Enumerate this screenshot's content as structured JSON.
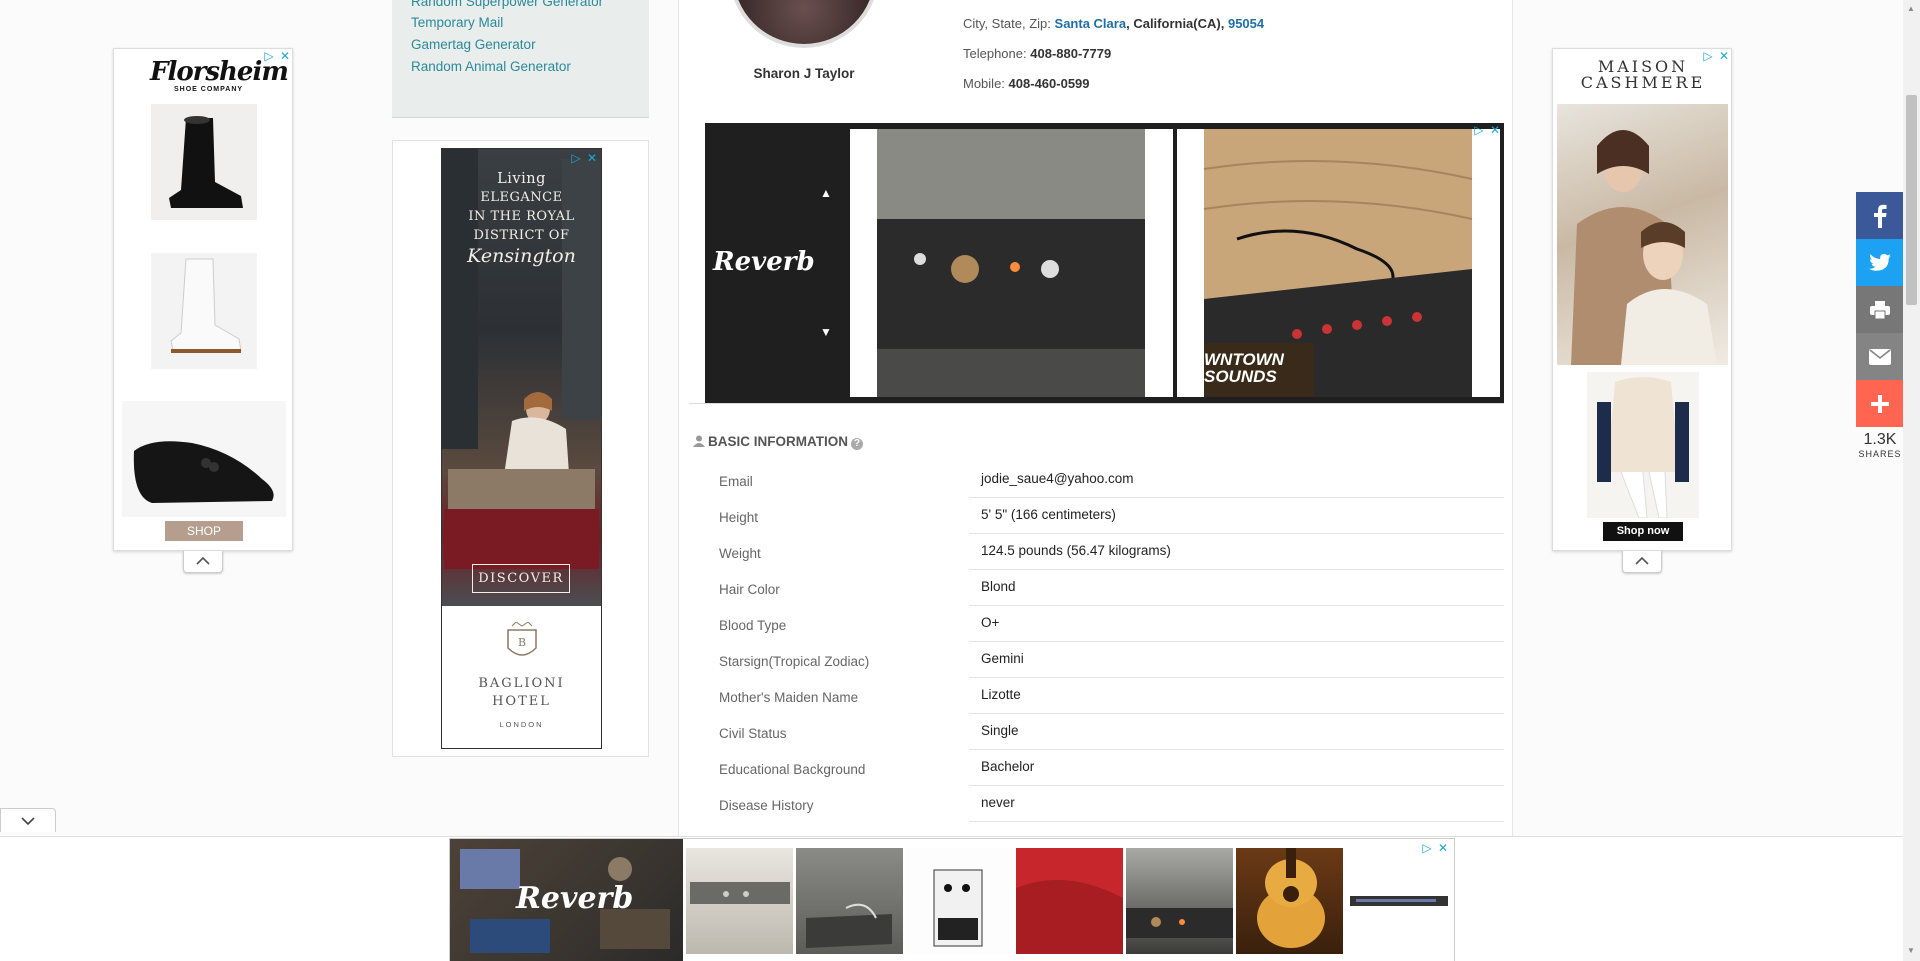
{
  "sidebar": {
    "links": [
      "Random Superpower Generator",
      "Temporary Mail",
      "Gamertag Generator",
      "Random Animal Generator"
    ]
  },
  "ads": {
    "florsheim": {
      "brand": "Florsheim",
      "sub": "SHOE COMPANY",
      "cta": "SHOP"
    },
    "maison": {
      "brand_line1": "MAISON",
      "brand_line2": "CASHMERE",
      "cta": "Shop now"
    },
    "baglioni": {
      "lines": [
        "Living",
        "Elegance",
        "in the Royal",
        "District of"
      ],
      "script": "Kensington",
      "cta": "DISCOVER",
      "brand1": "BAGLIONI",
      "brand2": "HOTEL",
      "city": "LONDON"
    },
    "reverb_brand": "Reverb",
    "reverb_photo_text": "WNTOWN SOUNDS",
    "adchoices": "▷",
    "close": "✕"
  },
  "profile": {
    "name": "Sharon J Taylor",
    "city_label": "City, State, Zip:",
    "city": "Santa Clara",
    "state": "California(CA)",
    "zip": "95054",
    "telephone_label": "Telephone:",
    "telephone": "408-880-7779",
    "mobile_label": "Mobile:",
    "mobile": "408-460-0599"
  },
  "basic_info": {
    "title": "BASIC INFORMATION",
    "rows": [
      {
        "label": "Email",
        "value": "jodie_saue4@yahoo.com"
      },
      {
        "label": "Height",
        "value": "5' 5\" (166 centimeters)"
      },
      {
        "label": "Weight",
        "value": "124.5 pounds (56.47 kilograms)"
      },
      {
        "label": "Hair Color",
        "value": "Blond"
      },
      {
        "label": "Blood Type",
        "value": "O+"
      },
      {
        "label": "Starsign(Tropical Zodiac)",
        "value": "Gemini"
      },
      {
        "label": "Mother's Maiden Name",
        "value": "Lizotte"
      },
      {
        "label": "Civil Status",
        "value": "Single"
      },
      {
        "label": "Educational Background",
        "value": "Bachelor"
      },
      {
        "label": "Disease History",
        "value": "never"
      }
    ]
  },
  "share": {
    "count": "1.3K",
    "label": "SHARES"
  },
  "colors": {
    "facebook": "#3b5998",
    "twitter": "#1da1f2",
    "print": "#777777",
    "email": "#848484",
    "more": "#ff6550",
    "link": "#2a8a99"
  }
}
